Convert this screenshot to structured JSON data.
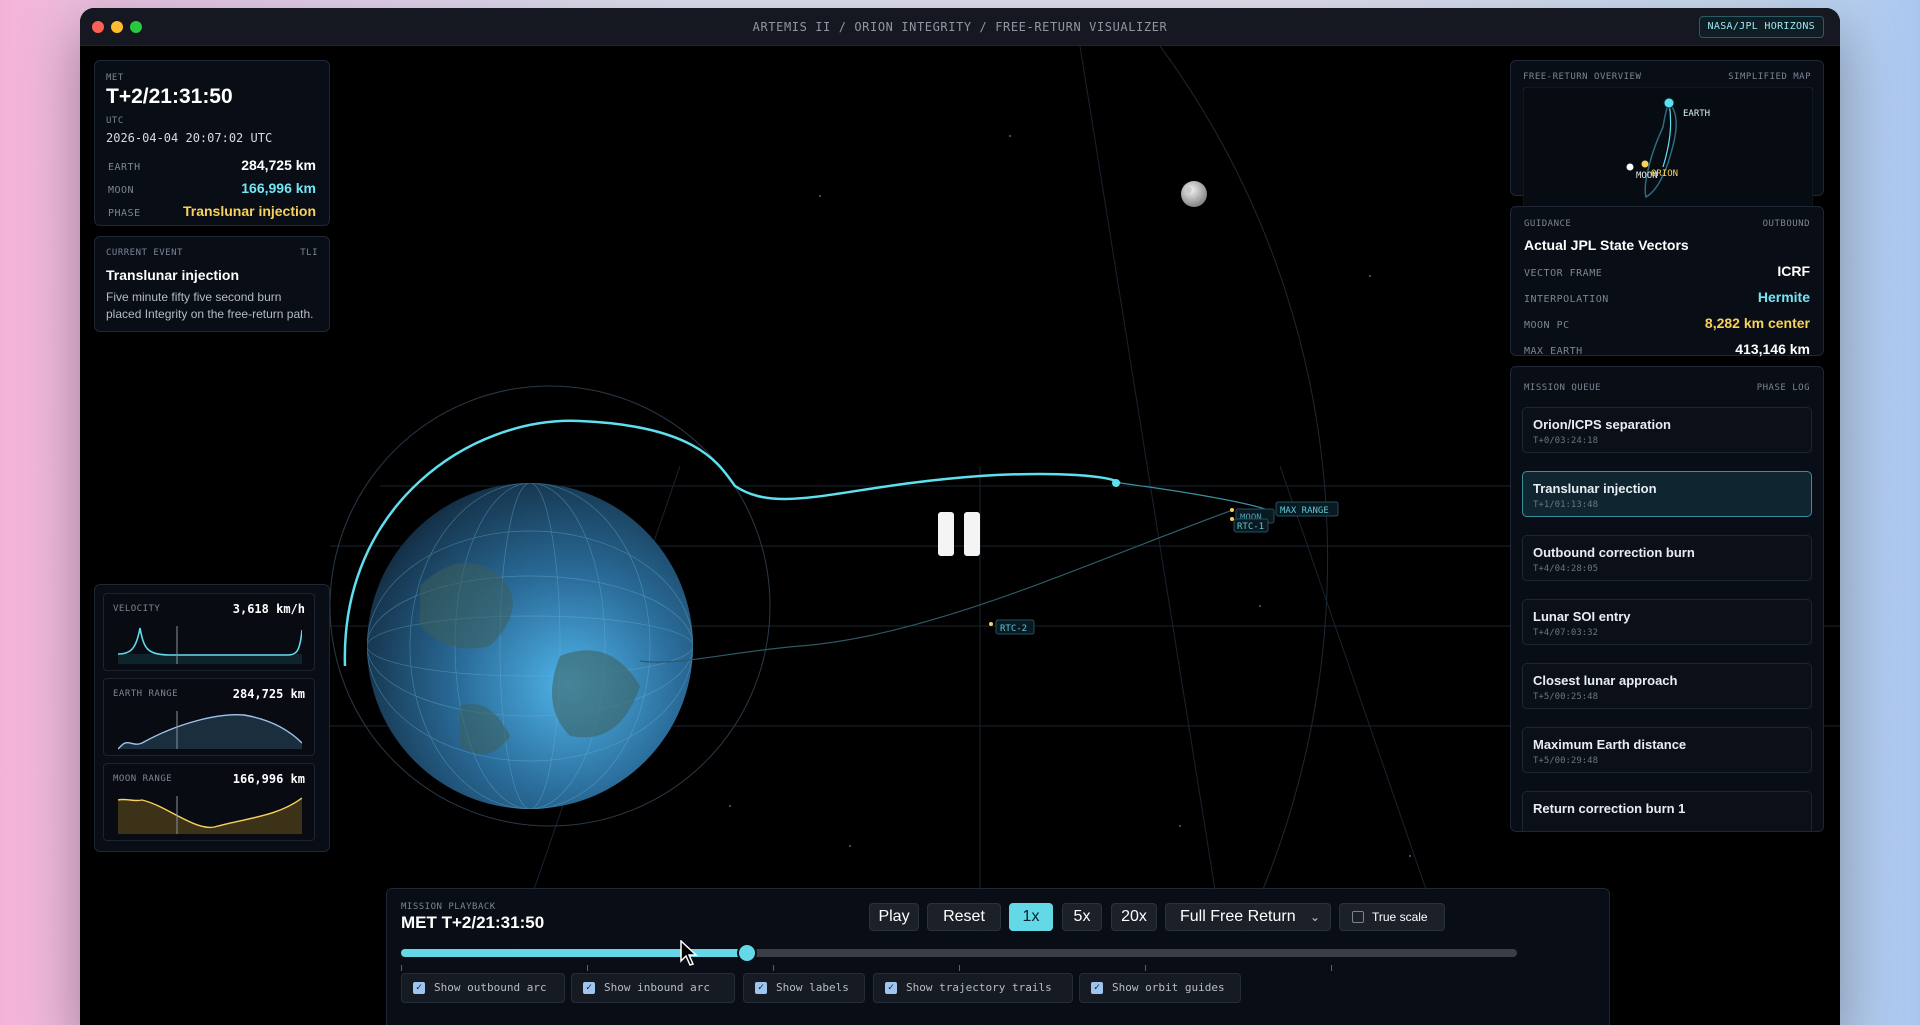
{
  "window": {
    "title": "ARTEMIS II / ORION INTEGRITY / FREE-RETURN VISUALIZER",
    "source_badge": "NASA/JPL HORIZONS"
  },
  "telemetry": {
    "met_label": "MET",
    "met_value": "T+2/21:31:50",
    "utc_label": "UTC",
    "utc_value": "2026-04-04 20:07:02 UTC",
    "earth_label": "EARTH",
    "earth_value": "284,725 km",
    "moon_label": "MOON",
    "moon_value": "166,996 km",
    "phase_label": "PHASE",
    "phase_value": "Translunar injection"
  },
  "current_event": {
    "label": "CURRENT EVENT",
    "tag": "TLI",
    "title": "Translunar injection",
    "description": "Five minute fifty five second burn placed Integrity on the free-return path."
  },
  "mini_charts": {
    "velocity": {
      "label": "VELOCITY",
      "value": "3,618 km/h"
    },
    "earth_range": {
      "label": "EARTH RANGE",
      "value": "284,725 km"
    },
    "moon_range": {
      "label": "MOON RANGE",
      "value": "166,996 km"
    }
  },
  "scene": {
    "labels": {
      "max_range": "MAX RANGE",
      "moon": "MOON",
      "rtc1": "RTC-1",
      "rtc2": "RTC-2"
    }
  },
  "overview": {
    "label": "FREE-RETURN OVERVIEW",
    "tag": "SIMPLIFIED MAP",
    "earth": "EARTH",
    "moon": "MOON",
    "orion": "ORION"
  },
  "guidance": {
    "label": "GUIDANCE",
    "tag": "OUTBOUND",
    "title": "Actual JPL State Vectors",
    "rows": [
      {
        "label": "VECTOR FRAME",
        "value": "ICRF"
      },
      {
        "label": "INTERPOLATION",
        "value": "Hermite"
      },
      {
        "label": "MOON PC",
        "value": "8,282 km center"
      },
      {
        "label": "MAX EARTH",
        "value": "413,146 km"
      }
    ]
  },
  "queue": {
    "label": "MISSION QUEUE",
    "tag": "PHASE LOG",
    "items": [
      {
        "title": "Orion/ICPS separation",
        "time": "T+0/03:24:18"
      },
      {
        "title": "Translunar injection",
        "time": "T+1/01:13:48"
      },
      {
        "title": "Outbound correction burn",
        "time": "T+4/04:28:05"
      },
      {
        "title": "Lunar SOI entry",
        "time": "T+4/07:03:32"
      },
      {
        "title": "Closest lunar approach",
        "time": "T+5/00:25:48"
      },
      {
        "title": "Maximum Earth distance",
        "time": "T+5/00:29:48"
      },
      {
        "title": "Return correction burn 1",
        "time": ""
      }
    ]
  },
  "playback": {
    "label": "MISSION PLAYBACK",
    "met": "MET T+2/21:31:50",
    "progress": 0.31,
    "buttons": {
      "play": "Play",
      "reset": "Reset",
      "speed1": "1x",
      "speed5": "5x",
      "speed20": "20x"
    },
    "view_select": "Full Free Return",
    "true_scale": "True scale",
    "checkboxes": {
      "outbound": "Show outbound arc",
      "inbound": "Show inbound arc",
      "labels": "Show labels",
      "trails": "Show trajectory trails",
      "guides": "Show orbit guides"
    }
  },
  "colors": {
    "accent": "#63d9e8",
    "phase": "#f8d25c",
    "trajectory": "#5ee0ef"
  }
}
